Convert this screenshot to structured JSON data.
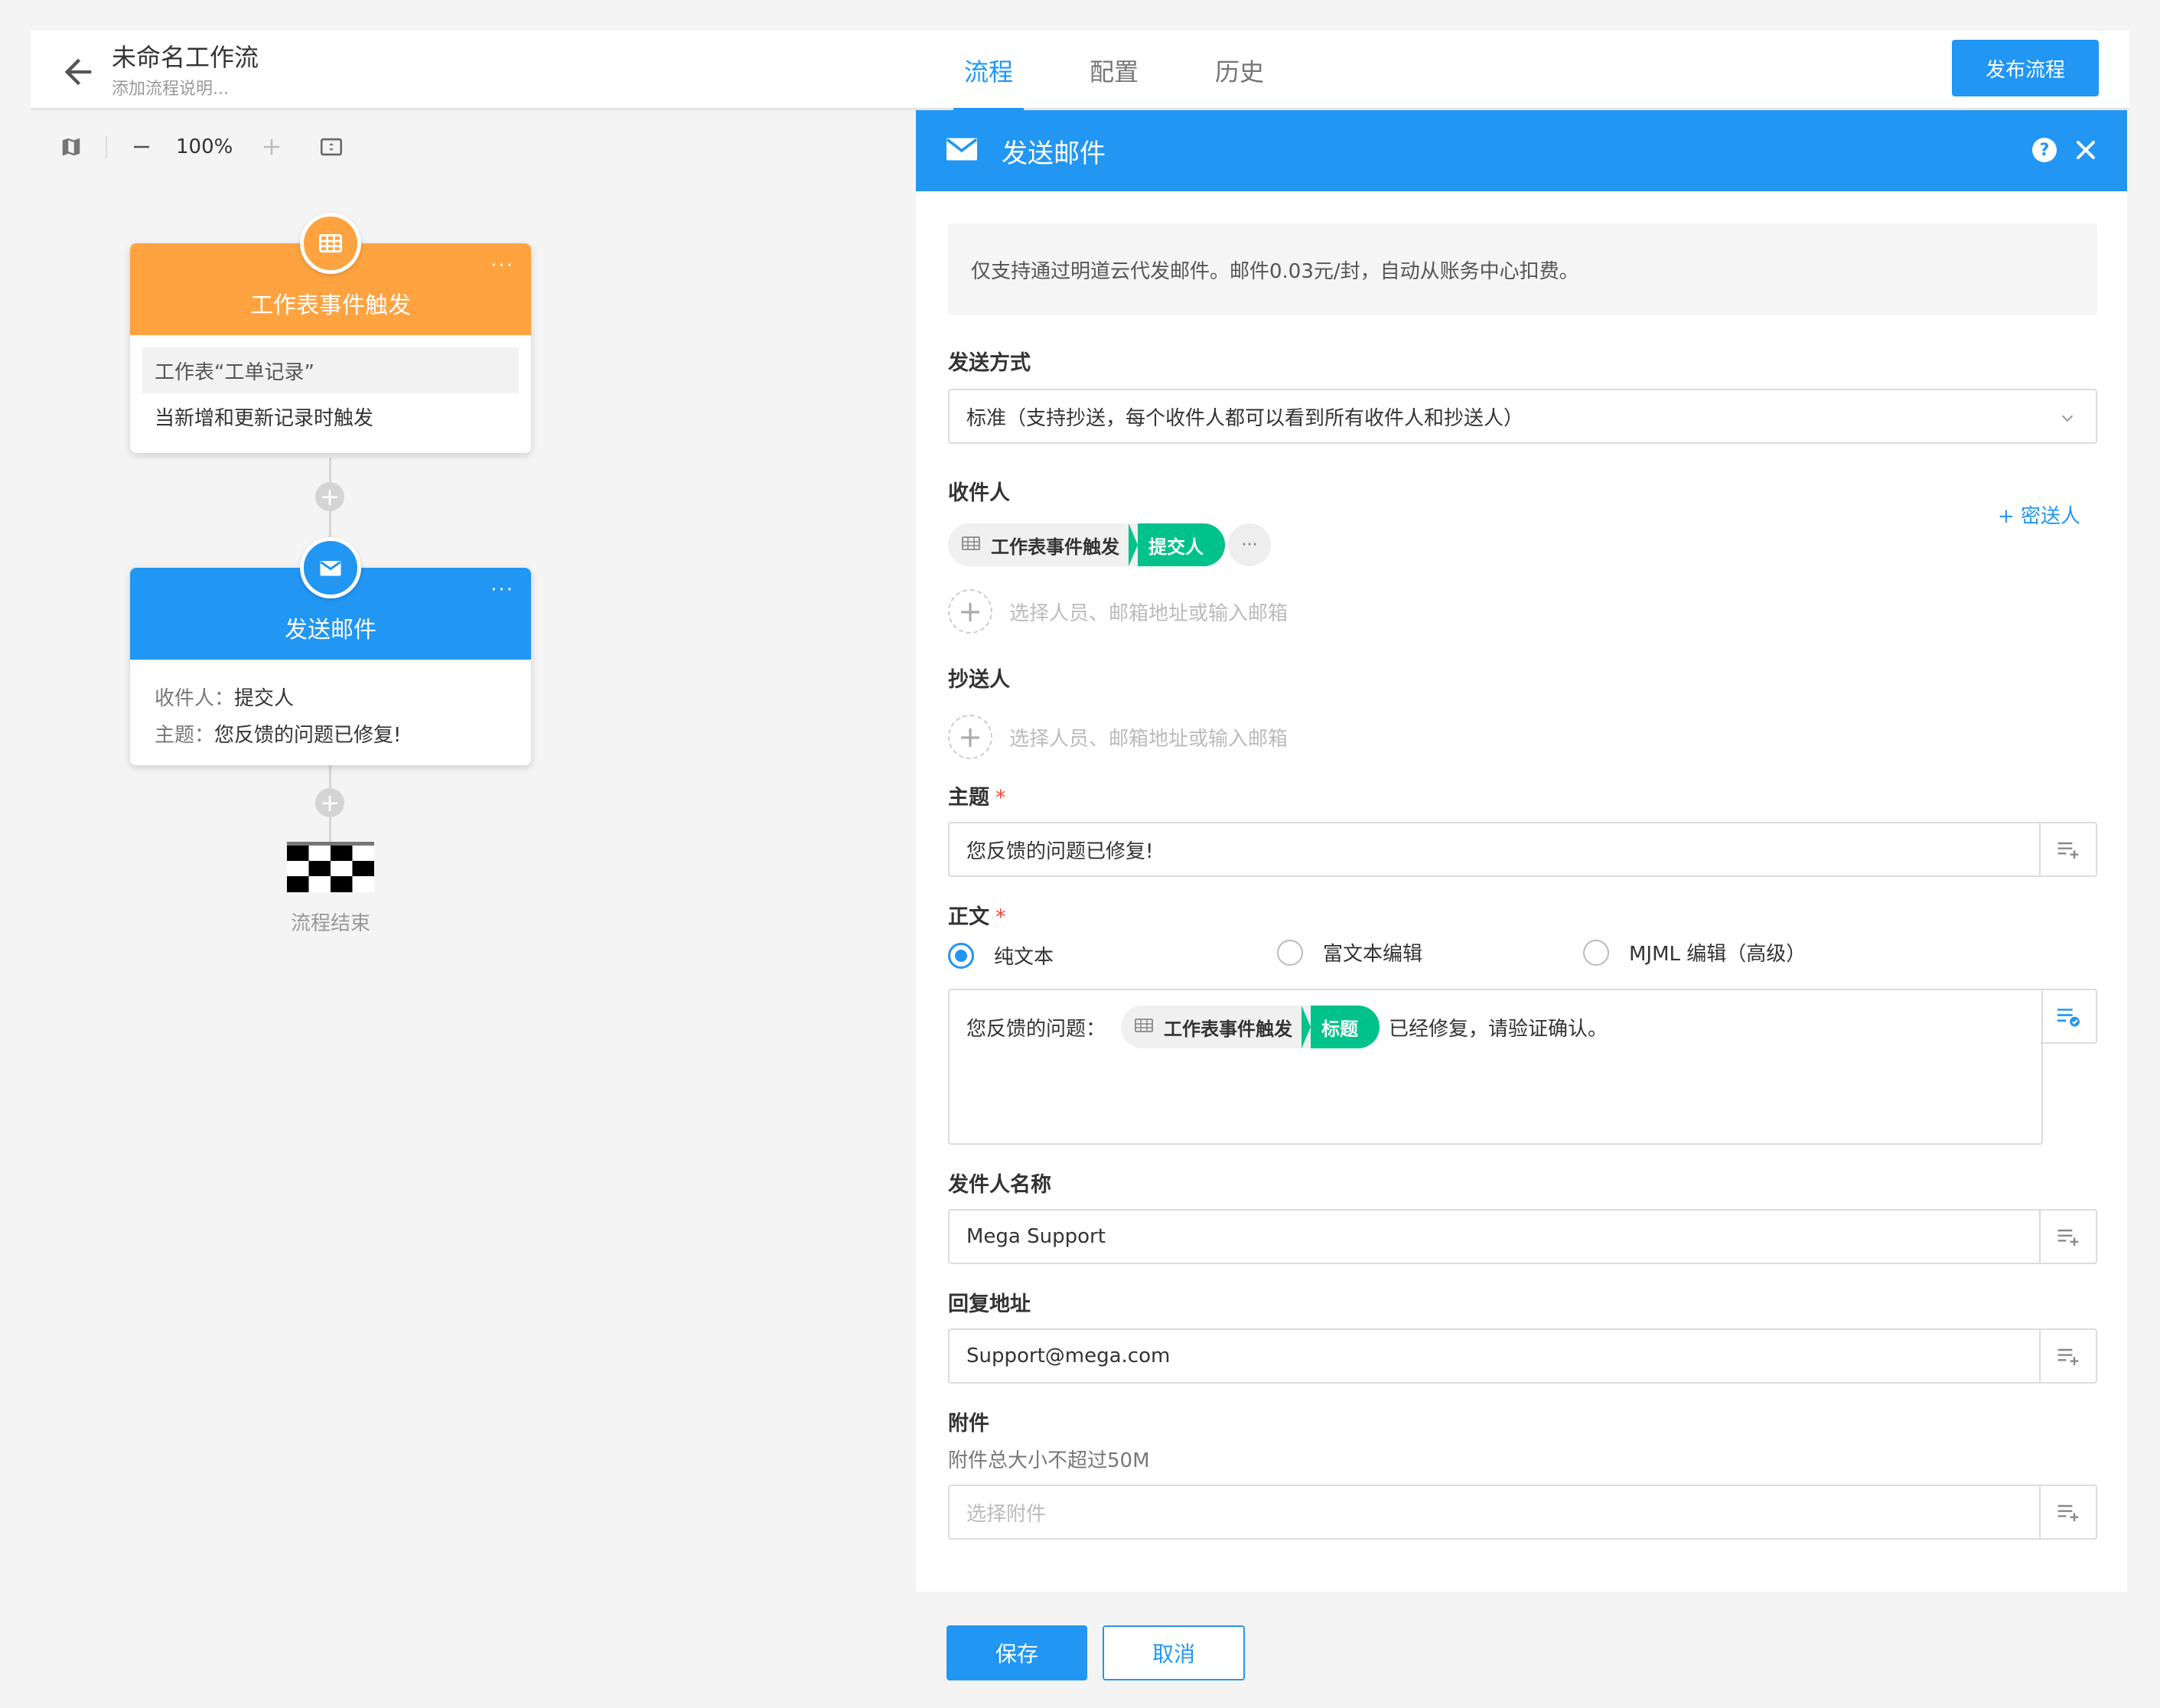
{
  "header": {
    "title": "未命名工作流",
    "description": "添加流程说明...",
    "tabs": [
      {
        "label": "流程",
        "active": true
      },
      {
        "label": "配置",
        "active": false
      },
      {
        "label": "历史",
        "active": false
      }
    ],
    "publish_label": "发布流程"
  },
  "canvas_toolbar": {
    "zoom": "100%",
    "icons": [
      "map-icon",
      "zoom-out-icon",
      "zoom-in-icon",
      "fit-screen-icon"
    ]
  },
  "flow": {
    "trigger_node": {
      "title": "工作表事件触发",
      "sheet_text": "工作表“工单记录”",
      "condition_text": "当新增和更新记录时触发",
      "color": "#ffa340"
    },
    "email_node": {
      "title": "发送邮件",
      "recipient_label": "收件人：",
      "recipient_value": "提交人",
      "subject_label": "主题：",
      "subject_value": "您反馈的问题已修复!",
      "color": "#2196f3"
    },
    "end_label": "流程结束"
  },
  "panel": {
    "title": "发送邮件",
    "notice": "仅支持通过明道云代发邮件。邮件0.03元/封，自动从账务中心扣费。",
    "send_mode": {
      "label": "发送方式",
      "value": "标准（支持抄送，每个收件人都可以看到所有收件人和抄送人）"
    },
    "recipients": {
      "label": "收件人",
      "bcc_link": "+ 密送人",
      "chip_source": "工作表事件触发",
      "chip_field": "提交人",
      "add_placeholder": "选择人员、邮箱地址或输入邮箱"
    },
    "cc": {
      "label": "抄送人",
      "add_placeholder": "选择人员、邮箱地址或输入邮箱"
    },
    "subject": {
      "label": "主题",
      "required_mark": "*",
      "value": "您反馈的问题已修复!"
    },
    "body": {
      "label": "正文",
      "required_mark": "*",
      "modes": [
        {
          "label": "纯文本",
          "checked": true
        },
        {
          "label": "富文本编辑",
          "checked": false
        },
        {
          "label": "MJML 编辑（高级）",
          "checked": false
        }
      ],
      "text_before": "您反馈的问题：",
      "chip_source": "工作表事件触发",
      "chip_field": "标题",
      "text_after": "已经修复，请验证确认。"
    },
    "sender_name": {
      "label": "发件人名称",
      "value": "Mega Support"
    },
    "reply_to": {
      "label": "回复地址",
      "value": "Support@mega.com"
    },
    "attachments": {
      "label": "附件",
      "hint": "附件总大小不超过50M",
      "placeholder": "选择附件"
    },
    "save_label": "保存",
    "cancel_label": "取消"
  },
  "colors": {
    "primary": "#2196f3",
    "trigger": "#ffa340",
    "chip_green": "#00c28a",
    "required": "#f44336"
  }
}
